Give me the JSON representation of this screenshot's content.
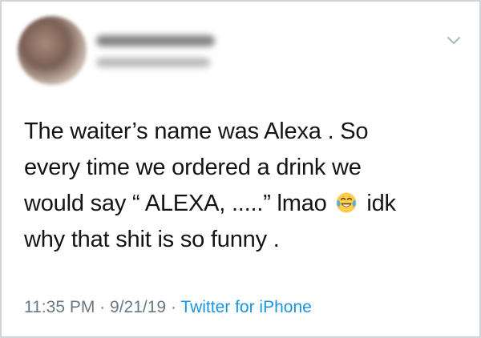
{
  "tweet": {
    "lines": [
      "The waiter’s name was Alexa . So",
      "every time we ordered a drink we",
      "would say “ ALEXA, .....” lmao",
      "idk",
      "why that shit is so funny ."
    ],
    "emoji": "face-with-tears-of-joy"
  },
  "meta": {
    "time": "11:35 PM",
    "separator": "·",
    "date": "9/21/19",
    "source": "Twitter for iPhone"
  },
  "icons": {
    "menu": "chevron-down-icon"
  },
  "colors": {
    "text": "#141414",
    "meta": "#697882",
    "link": "#1b95e0",
    "border": "#cfd3d6"
  }
}
